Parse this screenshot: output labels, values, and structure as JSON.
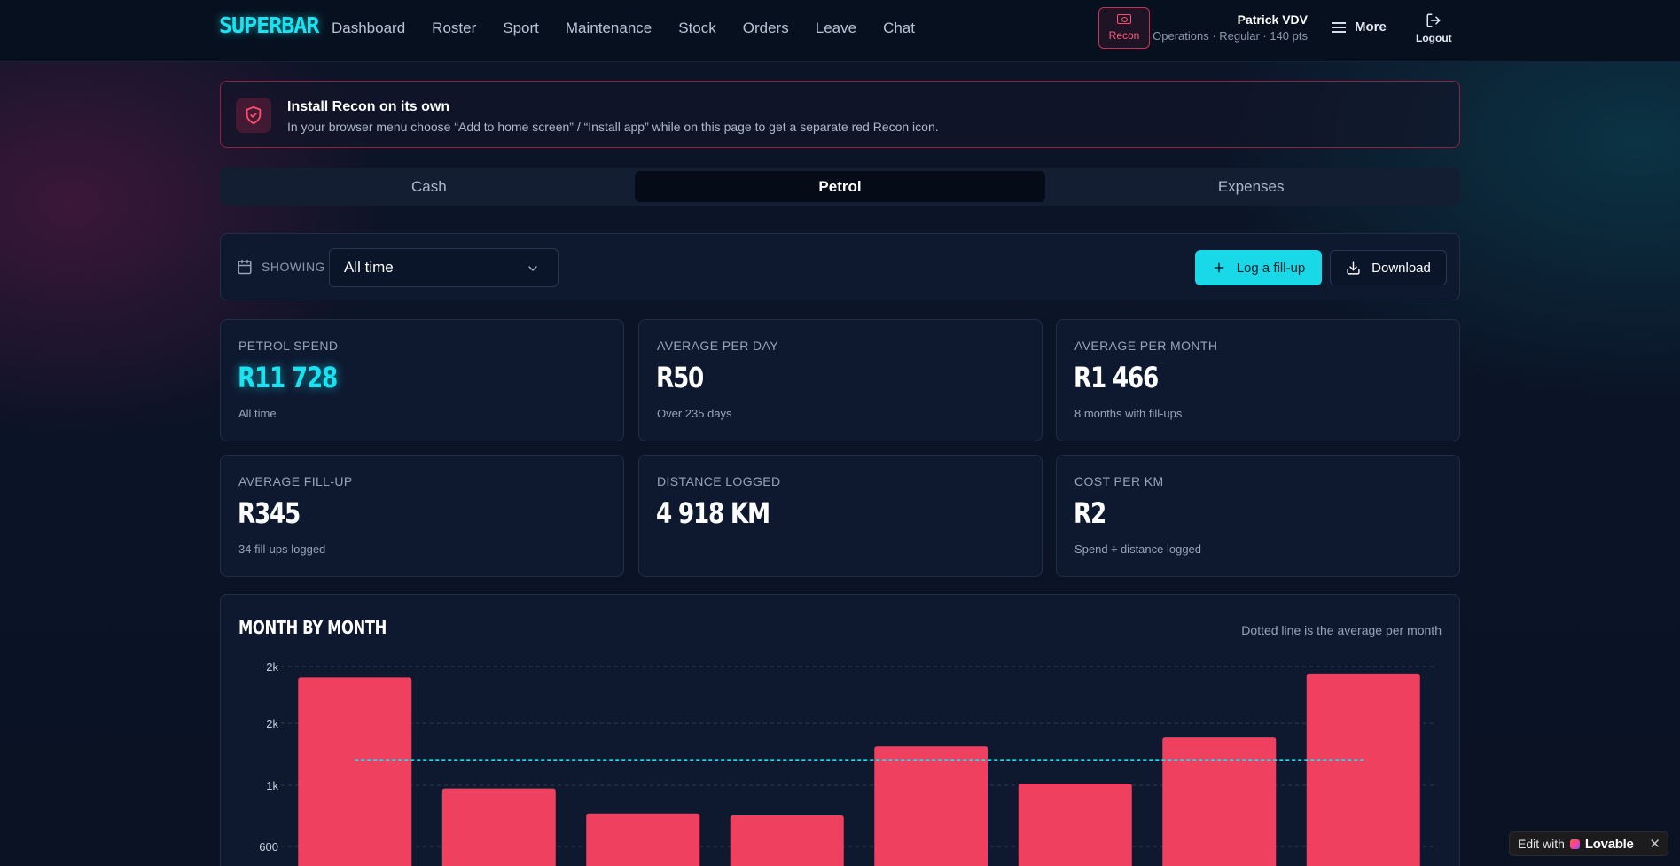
{
  "app": {
    "logo": "SUPERBAR"
  },
  "nav": {
    "items": [
      "Dashboard",
      "Roster",
      "Sport",
      "Maintenance",
      "Stock",
      "Orders",
      "Leave",
      "Chat"
    ]
  },
  "header": {
    "recon_label": "Recon",
    "user_name": "Patrick VDV",
    "user_meta": "Operations · Regular · 140 pts",
    "more_label": "More",
    "logout_label": "Logout"
  },
  "banner": {
    "title": "Install Recon on its own",
    "description": "In your browser menu choose “Add to home screen” / “Install app” while on this page to get a separate red Recon icon."
  },
  "tabs": [
    {
      "label": "Cash",
      "active": false
    },
    {
      "label": "Petrol",
      "active": true
    },
    {
      "label": "Expenses",
      "active": false
    }
  ],
  "filter": {
    "showing_label": "SHOWING",
    "selected": "All time",
    "log_button": "Log a fill-up",
    "download_button": "Download"
  },
  "stats": [
    {
      "label": "PETROL SPEND",
      "value": "R11 728",
      "sub": "All time",
      "accent": true
    },
    {
      "label": "AVERAGE PER DAY",
      "value": "R50",
      "sub": "Over 235 days",
      "accent": false
    },
    {
      "label": "AVERAGE PER MONTH",
      "value": "R1 466",
      "sub": "8 months with fill-ups",
      "accent": false
    },
    {
      "label": "AVERAGE FILL-UP",
      "value": "R345",
      "sub": "34 fill-ups logged",
      "accent": false
    },
    {
      "label": "DISTANCE LOGGED",
      "value": "4 918 KM",
      "sub": "",
      "accent": false
    },
    {
      "label": "COST PER KM",
      "value": "R2",
      "sub": "Spend ÷ distance logged",
      "accent": false
    }
  ],
  "colors": {
    "accent": "#19e3f0",
    "bar": "#f0405f",
    "danger": "#c7334f"
  },
  "chart_data": {
    "type": "bar",
    "title": "MONTH BY MONTH",
    "note": "Dotted line is the average per month",
    "ytick_labels": [
      "2k",
      "2k",
      "1k",
      "600"
    ],
    "ytick_values": [
      2400,
      1800,
      1200,
      600
    ],
    "values": [
      2290,
      1180,
      930,
      910,
      1600,
      1230,
      1690,
      2330
    ],
    "average": 1466,
    "series_color": "#f0405f",
    "average_color": "#19e3f0",
    "grid": true
  },
  "badge": {
    "edit_with": "Edit with",
    "brand": "Lovable"
  }
}
